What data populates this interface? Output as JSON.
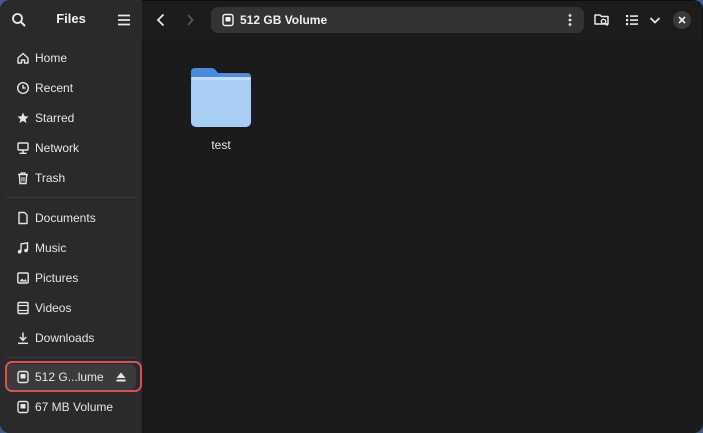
{
  "sidebar": {
    "title": "Files",
    "places": [
      {
        "label": "Home",
        "icon": "home-icon"
      },
      {
        "label": "Recent",
        "icon": "clock-icon"
      },
      {
        "label": "Starred",
        "icon": "star-icon"
      },
      {
        "label": "Network",
        "icon": "network-icon"
      },
      {
        "label": "Trash",
        "icon": "trash-icon"
      }
    ],
    "bookmarks": [
      {
        "label": "Documents",
        "icon": "document-icon"
      },
      {
        "label": "Music",
        "icon": "music-icon"
      },
      {
        "label": "Pictures",
        "icon": "picture-icon"
      },
      {
        "label": "Videos",
        "icon": "video-icon"
      },
      {
        "label": "Downloads",
        "icon": "download-icon"
      }
    ],
    "devices": [
      {
        "label": "512 G...lume",
        "icon": "drive-icon",
        "eject": true,
        "selected": true
      },
      {
        "label": "67 MB Volume",
        "icon": "drive-icon",
        "eject": false,
        "selected": false
      }
    ]
  },
  "header": {
    "location": "512 GB Volume"
  },
  "content": {
    "items": [
      {
        "name": "test",
        "type": "folder"
      }
    ]
  },
  "colors": {
    "highlight": "#e0504a",
    "folder": "#a8cdf5",
    "folder_tab": "#4a8de0"
  }
}
